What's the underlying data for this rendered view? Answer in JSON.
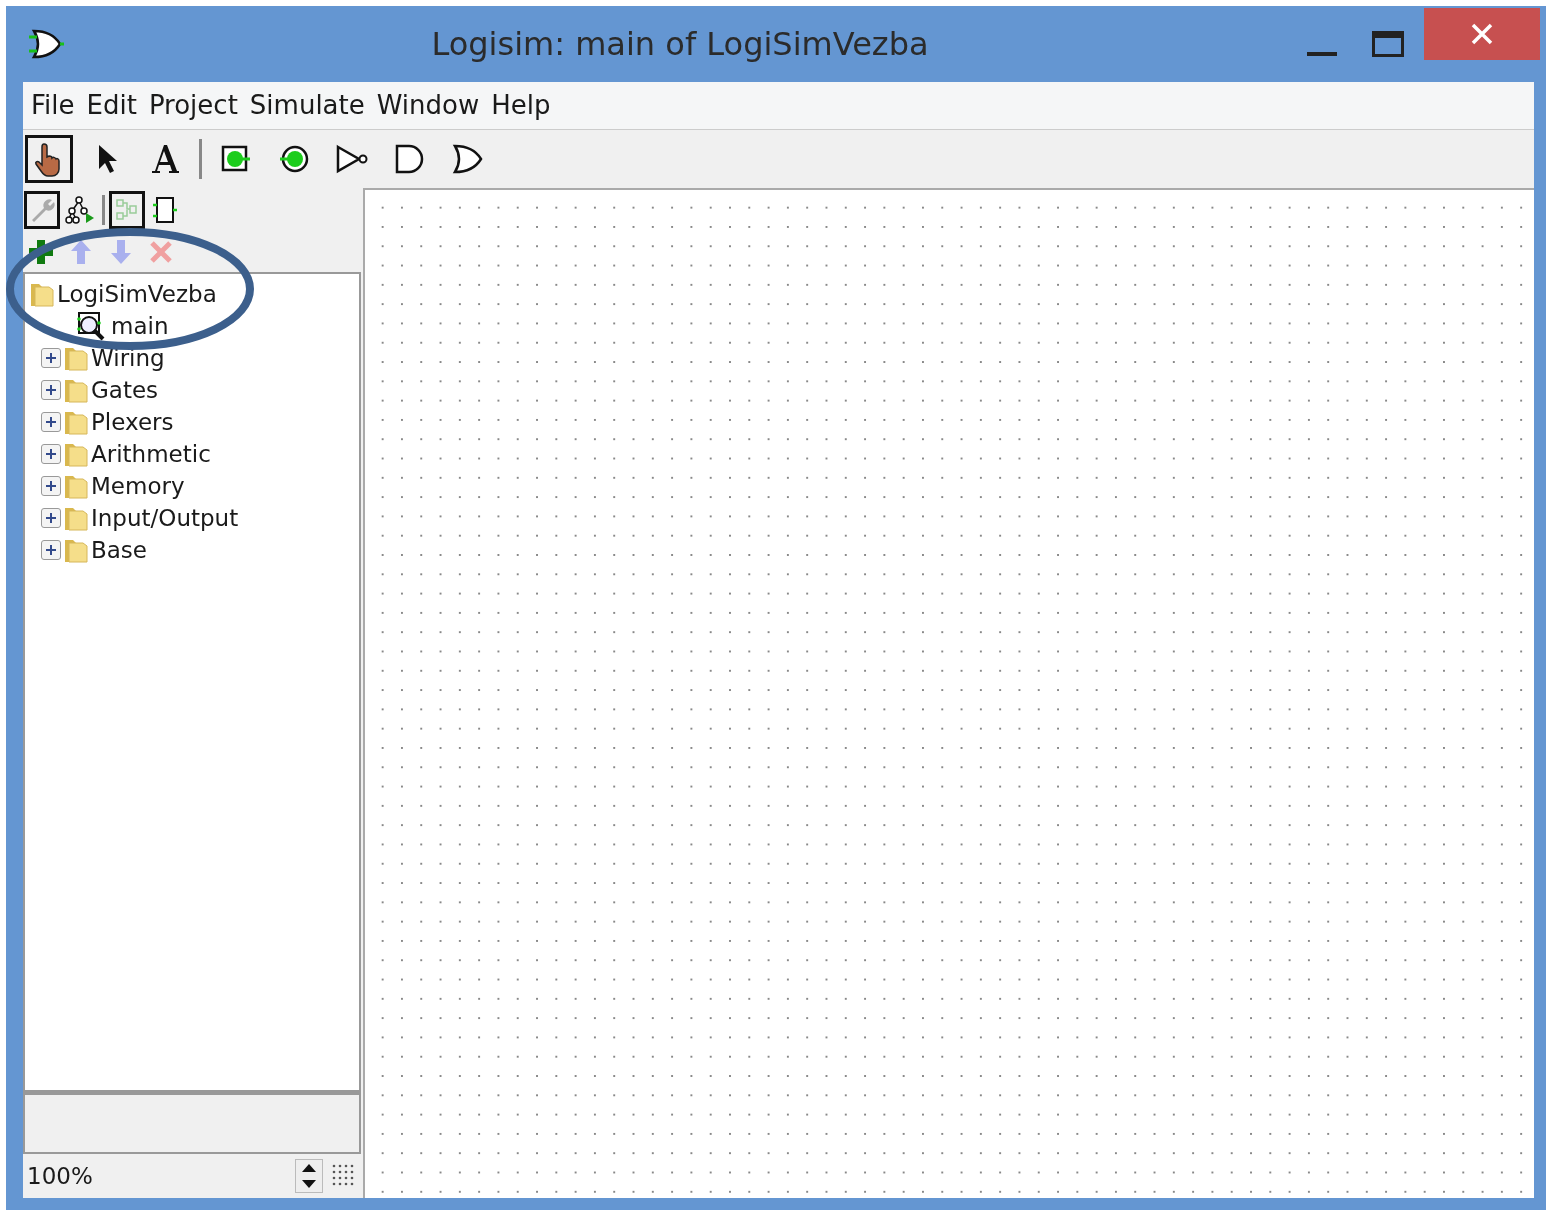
{
  "window": {
    "title": "Logisim: main of LogiSimVezba"
  },
  "menu": [
    "File",
    "Edit",
    "Project",
    "Simulate",
    "Window",
    "Help"
  ],
  "tools": [
    {
      "kind": "poke",
      "selected": true
    },
    {
      "kind": "select",
      "selected": false
    },
    {
      "kind": "text",
      "selected": false
    },
    {
      "kind": "separator"
    },
    {
      "kind": "input",
      "selected": false
    },
    {
      "kind": "output",
      "selected": false
    },
    {
      "kind": "not",
      "selected": false
    },
    {
      "kind": "and",
      "selected": false
    },
    {
      "kind": "or",
      "selected": false
    }
  ],
  "explorer_toolbar": [
    {
      "kind": "wrench",
      "selected": true
    },
    {
      "kind": "simtree",
      "selected": false
    },
    {
      "kind": "separator"
    },
    {
      "kind": "layout",
      "selected": true
    },
    {
      "kind": "appearance",
      "selected": false
    }
  ],
  "circuit_buttons": [
    {
      "kind": "add",
      "disabled": false
    },
    {
      "kind": "up",
      "disabled": true
    },
    {
      "kind": "down",
      "disabled": true
    },
    {
      "kind": "delete",
      "disabled": true
    }
  ],
  "tree": [
    {
      "label": "LogiSimVezba",
      "kind": "project",
      "children": [
        {
          "label": "main",
          "kind": "circuit"
        },
        {
          "label": "Wiring",
          "kind": "library",
          "expanded": false
        },
        {
          "label": "Gates",
          "kind": "library",
          "expanded": false
        },
        {
          "label": "Plexers",
          "kind": "library",
          "expanded": false
        },
        {
          "label": "Arithmetic",
          "kind": "library",
          "expanded": false
        },
        {
          "label": "Memory",
          "kind": "library",
          "expanded": false
        },
        {
          "label": "Input/Output",
          "kind": "library",
          "expanded": false
        },
        {
          "label": "Base",
          "kind": "library",
          "expanded": false
        }
      ]
    }
  ],
  "zoom": {
    "value": "100%"
  }
}
